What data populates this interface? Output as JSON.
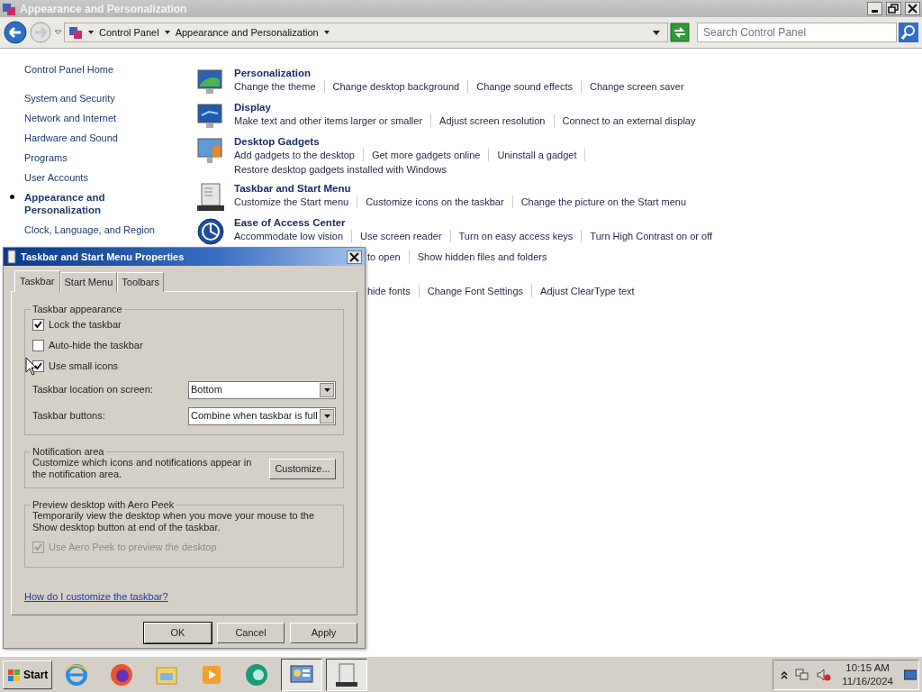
{
  "window": {
    "title": "Appearance and Personalization",
    "breadcrumb": [
      "Control Panel",
      "Appearance and Personalization"
    ],
    "search": {
      "placeholder": "Search Control Panel"
    }
  },
  "sidebar": {
    "home": "Control Panel Home",
    "items": [
      {
        "label": "System and Security",
        "selected": false
      },
      {
        "label": "Network and Internet",
        "selected": false
      },
      {
        "label": "Hardware and Sound",
        "selected": false
      },
      {
        "label": "Programs",
        "selected": false
      },
      {
        "label": "User Accounts",
        "selected": false
      },
      {
        "label": "Appearance and Personalization",
        "selected": true
      },
      {
        "label": "Clock, Language, and Region",
        "selected": false
      }
    ]
  },
  "categories": [
    {
      "kind": "full",
      "title": "Personalization",
      "links": [
        "Change the theme",
        "Change desktop background",
        "Change sound effects",
        "Change screen saver"
      ]
    },
    {
      "kind": "full",
      "title": "Display",
      "links": [
        "Make text and other items larger or smaller",
        "Adjust screen resolution",
        "Connect to an external display"
      ]
    },
    {
      "kind": "full",
      "title": "Desktop Gadgets",
      "links": [
        "Add gadgets to the desktop",
        "Get more gadgets online",
        "Uninstall a gadget",
        "Restore desktop gadgets installed with Windows"
      ]
    },
    {
      "kind": "full",
      "title": "Taskbar and Start Menu",
      "links": [
        "Customize the Start menu",
        "Customize icons on the taskbar",
        "Change the picture on the Start menu"
      ]
    },
    {
      "kind": "full",
      "title": "Ease of Access Center",
      "links": [
        "Accommodate low vision",
        "Use screen reader",
        "Turn on easy access keys",
        "Turn High Contrast on or off"
      ]
    },
    {
      "kind": "covered",
      "links": [
        "to open",
        "Show hidden files and folders"
      ]
    },
    {
      "kind": "covered",
      "links": [
        "hide fonts",
        "Change Font Settings",
        "Adjust ClearType text"
      ]
    }
  ],
  "dialog": {
    "title": "Taskbar and Start Menu Properties",
    "tabs": [
      {
        "label": "Taskbar",
        "selected": true
      },
      {
        "label": "Start Menu",
        "selected": false
      },
      {
        "label": "Toolbars",
        "selected": false
      }
    ],
    "appearance": {
      "legend": "Taskbar appearance",
      "checkboxes": [
        {
          "label": "Lock the taskbar",
          "checked": true
        },
        {
          "label": "Auto-hide the taskbar",
          "checked": false
        },
        {
          "label": "Use small icons",
          "checked": true
        }
      ],
      "dropdowns": [
        {
          "label": "Taskbar location on screen:",
          "value": "Bottom"
        },
        {
          "label": "Taskbar buttons:",
          "value": "Combine when taskbar is full"
        }
      ]
    },
    "notification": {
      "legend": "Notification area",
      "text": "Customize which icons and notifications appear in the notification area.",
      "button": "Customize..."
    },
    "peek": {
      "legend": "Preview desktop with Aero Peek",
      "text": "Temporarily view the desktop when you move your mouse to the Show desktop button at end of the taskbar.",
      "checkbox": {
        "label": "Use Aero Peek to preview the desktop",
        "checked": true,
        "disabled": true
      }
    },
    "help_link": "How do I customize the taskbar?",
    "buttons": [
      {
        "label": "OK",
        "default": true
      },
      {
        "label": "Cancel",
        "default": false
      },
      {
        "label": "Apply",
        "default": false
      }
    ]
  },
  "taskbar": {
    "start": "Start",
    "apps": [
      {
        "pressed": false
      },
      {
        "pressed": false
      },
      {
        "pressed": false
      },
      {
        "pressed": false
      },
      {
        "pressed": false
      },
      {
        "pressed": true
      },
      {
        "pressed": true
      }
    ],
    "clock": {
      "time": "10:15 AM",
      "date": "11/16/2024"
    }
  }
}
